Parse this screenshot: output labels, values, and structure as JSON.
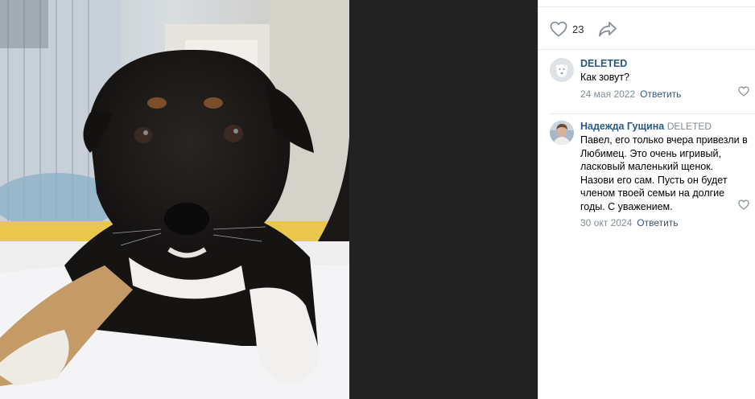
{
  "photo": {
    "subject": "black-and-tan puppy lying on a white blanket"
  },
  "actions": {
    "like_count": "23",
    "like_icon": "heart-outline-icon",
    "share_icon": "share-arrow-icon"
  },
  "comments": [
    {
      "author": "DELETED",
      "reply_to": "",
      "text": "Как зовут?",
      "date": "24 мая 2022",
      "reply_label": "Ответить",
      "avatar": "deleted-user-dog-avatar"
    },
    {
      "author": "Надежда Гущина",
      "reply_to": "DELETED",
      "text": "Павел, его только вчера привезли в Любимец. Это очень игривый, ласковый маленький щенок. Назови его сам. Пусть он будет членом твоей семьи на долгие годы. С уважением.",
      "date": "30 окт 2024",
      "reply_label": "Ответить",
      "avatar": "user-photo-avatar"
    }
  ],
  "colors": {
    "link": "#2a5885",
    "muted": "#818c99",
    "photo_backdrop": "#222222",
    "separator": "#e7e8ec"
  }
}
